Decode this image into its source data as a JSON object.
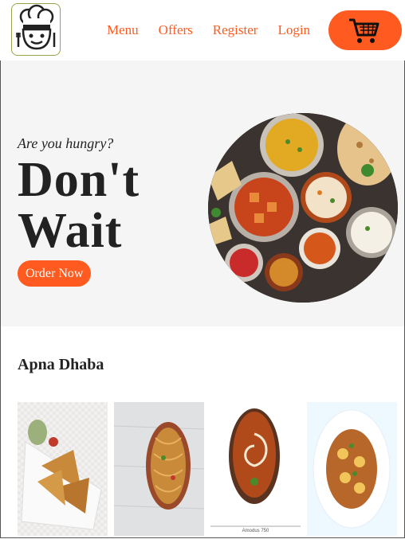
{
  "nav": {
    "links": [
      "Menu",
      "Offers",
      "Register",
      "Login"
    ],
    "cart_icon": "shopping-cart-icon",
    "logo_icon": "chef-logo-icon"
  },
  "hero": {
    "subtitle": "Are you hungry?",
    "title_line1": "Don't",
    "title_line2": "Wait",
    "cta": "Order Now"
  },
  "section": {
    "title": "Apna Dhaba",
    "cards": [
      {
        "icon": "samosa-image"
      },
      {
        "icon": "noodles-image"
      },
      {
        "icon": "dal-makhani-image",
        "caption": "Amodus 750"
      },
      {
        "icon": "curry-image"
      }
    ]
  },
  "colors": {
    "accent": "#ff5a1f",
    "hero_bg": "#f5f5f5",
    "text": "#222222"
  }
}
